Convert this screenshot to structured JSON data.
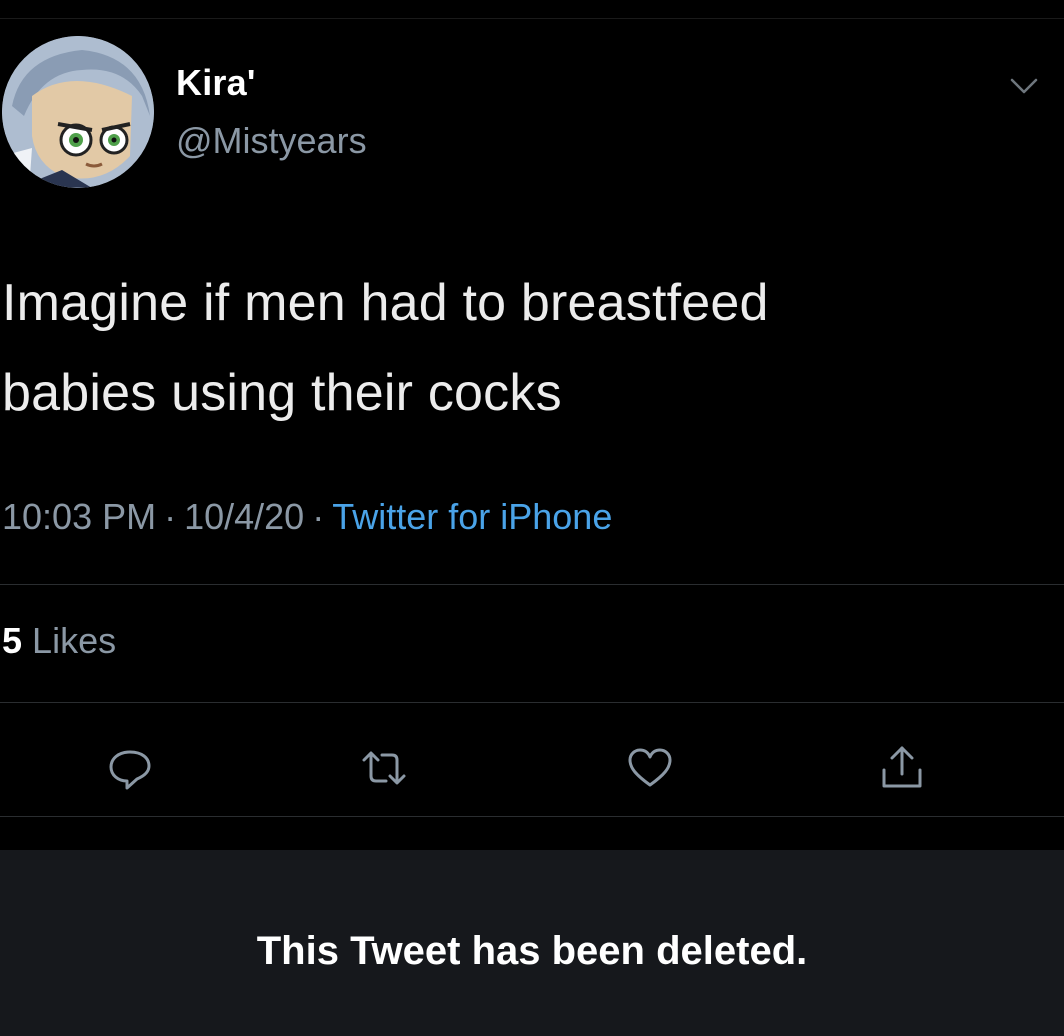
{
  "tweet": {
    "display_name": "Kira'",
    "handle": "@Mistyears",
    "text_line1": "Imagine if men had to breastfeed",
    "text_line2": "babies using their cocks",
    "time": "10:03 PM",
    "date": "10/4/20",
    "separator": "·",
    "source": "Twitter for iPhone",
    "likes_count": "5",
    "likes_label": "Likes"
  },
  "actions": {
    "reply_icon": "speech-bubble-icon",
    "retweet_icon": "retweet-arrows-icon",
    "like_icon": "heart-icon",
    "share_icon": "share-upload-icon"
  },
  "banner": {
    "deleted_text": "This Tweet has been deleted."
  },
  "colors": {
    "background": "#000000",
    "secondary_text": "#8b98a5",
    "link": "#4aa3e8",
    "banner_bg": "#16181c"
  }
}
